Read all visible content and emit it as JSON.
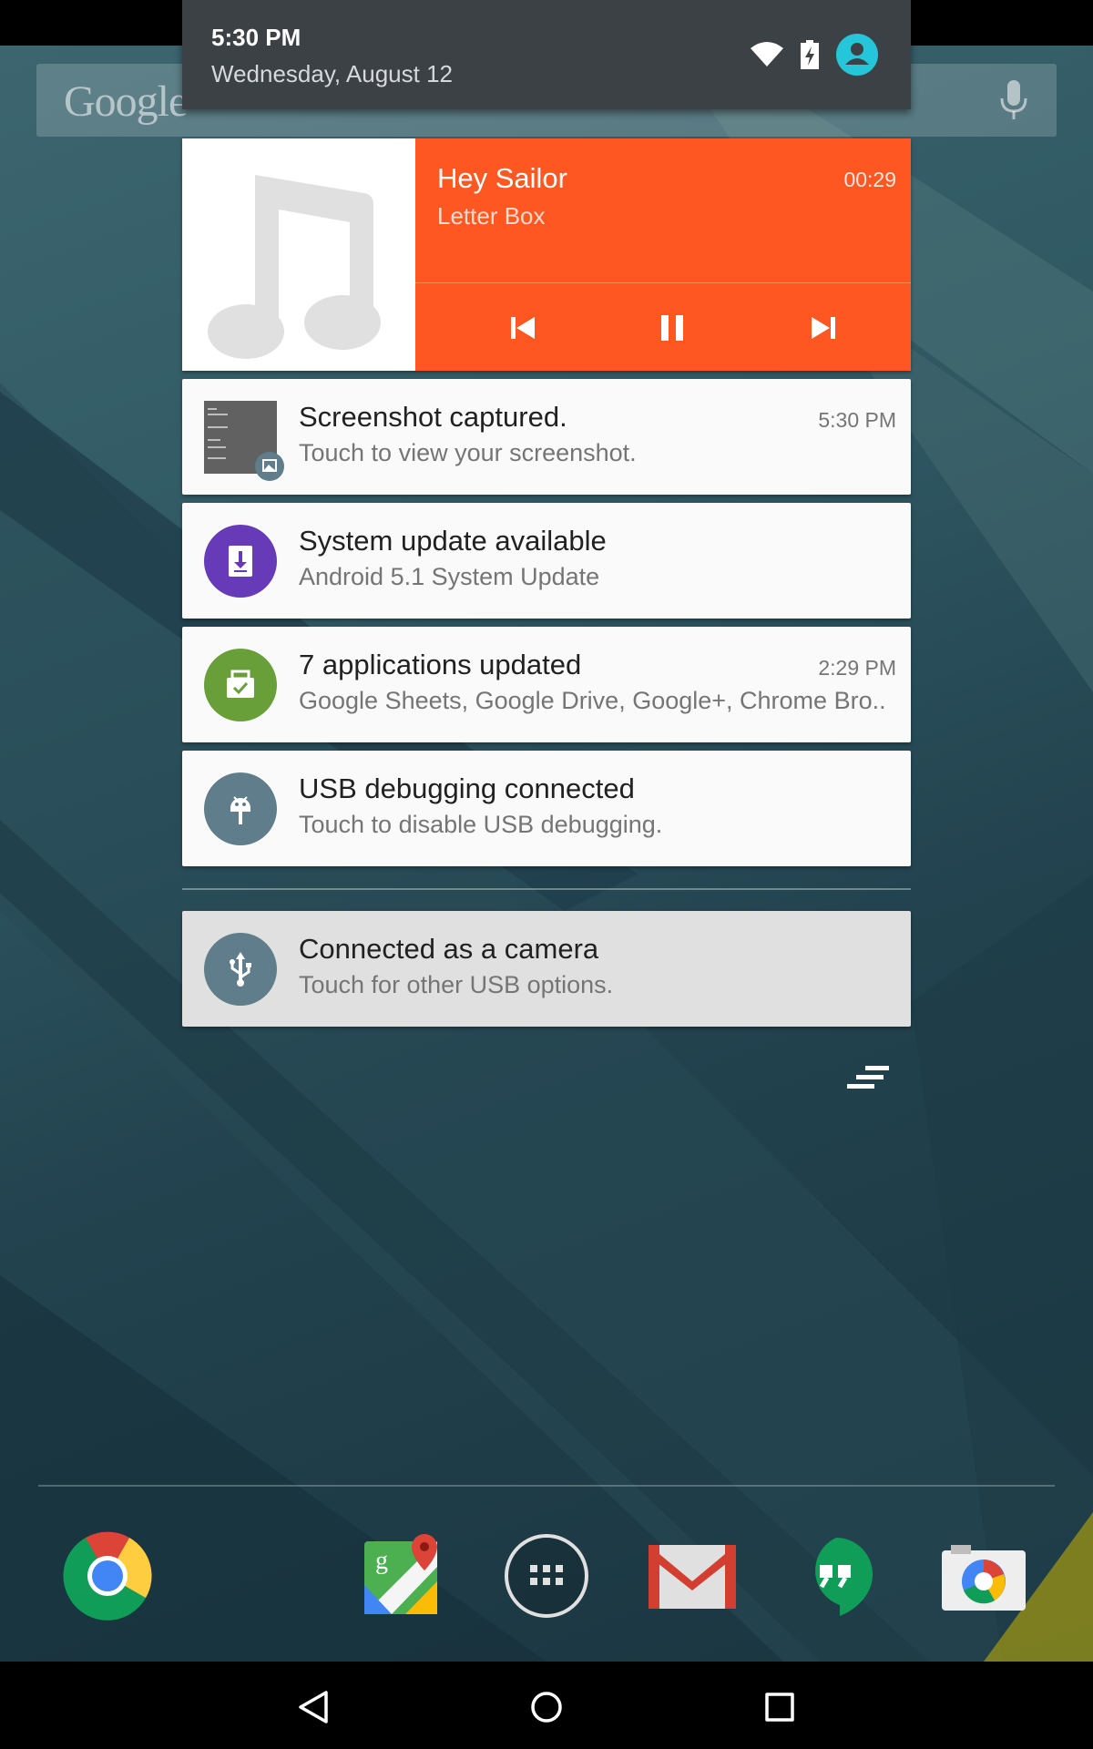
{
  "status_header": {
    "time": "5:30 PM",
    "date": "Wednesday, August 12",
    "icons": [
      "wifi-icon",
      "battery-charging-icon",
      "user-avatar-icon"
    ]
  },
  "search_bar": {
    "logo_text": "Google"
  },
  "media": {
    "title": "Hey Sailor",
    "artist": "Letter Box",
    "elapsed": "00:29",
    "accent_color": "#ff5722",
    "controls": [
      "previous-icon",
      "pause-icon",
      "next-icon"
    ]
  },
  "notifications": [
    {
      "title": "Screenshot captured.",
      "subtitle": "Touch to view your screenshot.",
      "time": "5:30 PM",
      "icon": "screenshot-thumbnail"
    },
    {
      "title": "System update available",
      "subtitle": "Android 5.1 System Update",
      "time": "",
      "icon": "system-update-icon",
      "color": "#673ab7"
    },
    {
      "title": "7 applications updated",
      "subtitle": "Google Sheets, Google Drive, Google+, Chrome Bro..",
      "time": "2:29 PM",
      "icon": "play-store-update-icon",
      "color": "#689f38"
    },
    {
      "title": "USB debugging connected",
      "subtitle": "Touch to disable USB debugging.",
      "time": "",
      "icon": "android-debug-icon",
      "color": "#607d8b"
    }
  ],
  "ongoing": {
    "title": "Connected as a camera",
    "subtitle": "Touch for other USB options.",
    "icon": "usb-icon",
    "color": "#607d8b"
  },
  "dock": [
    "chrome-icon",
    "maps-icon",
    "app-drawer-icon",
    "gmail-icon",
    "hangouts-icon",
    "camera-icon"
  ],
  "navbar": [
    "back-icon",
    "home-icon",
    "recents-icon"
  ]
}
